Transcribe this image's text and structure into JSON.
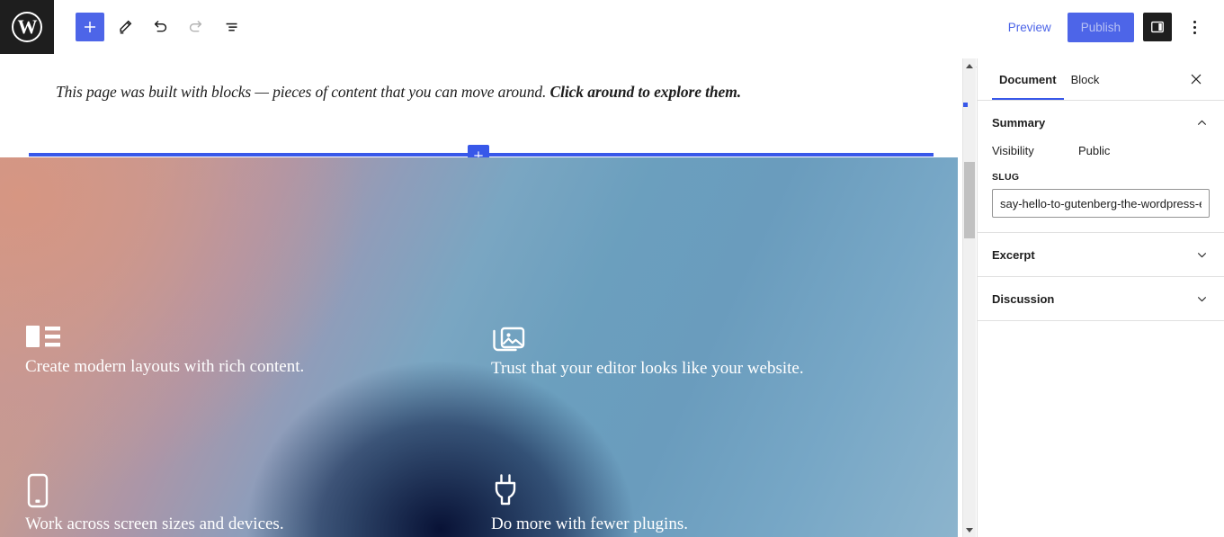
{
  "header": {
    "logo_title": "WordPress",
    "inserter_label": "Toggle block inserter",
    "tools": [
      {
        "name": "edit-pencil-icon",
        "label": "Tools",
        "disabled": false
      },
      {
        "name": "undo-icon",
        "label": "Undo",
        "disabled": false
      },
      {
        "name": "redo-icon",
        "label": "Redo",
        "disabled": true
      },
      {
        "name": "list-view-icon",
        "label": "Document Overview",
        "disabled": false
      }
    ],
    "preview_label": "Preview",
    "publish_label": "Publish",
    "sidebar_toggle_label": "Settings",
    "more_menu_label": "Options"
  },
  "editor": {
    "intro_text_plain": "This page was built with blocks — pieces of content that you can move around. ",
    "intro_text_bold": "Click around to explore them.",
    "inserter_between_label": "Add block",
    "cover": {
      "features": [
        {
          "icon": "columns-layout-icon",
          "text": "Create modern layouts with rich content."
        },
        {
          "icon": "image-gallery-icon",
          "text": "Trust that your editor looks like your website."
        },
        {
          "icon": "smartphone-icon",
          "text": "Work across screen sizes and devices."
        },
        {
          "icon": "plug-icon",
          "text": "Do more with fewer plugins."
        }
      ]
    },
    "scrollbar": {
      "up_label": "Scroll up",
      "down_label": "Scroll down",
      "thumb_label": "Vertical scrollbar thumb"
    }
  },
  "sidebar": {
    "tabs": [
      {
        "label": "Document",
        "active": true
      },
      {
        "label": "Block",
        "active": false
      }
    ],
    "close_label": "Close settings",
    "panels": [
      {
        "title": "Summary",
        "expanded": true
      },
      {
        "title": "Excerpt",
        "expanded": false
      },
      {
        "title": "Discussion",
        "expanded": false
      }
    ],
    "summary": {
      "visibility_label": "Visibility",
      "visibility_value": "Public",
      "slug_label": "SLUG",
      "slug_value": "say-hello-to-gutenberg-the-wordpress-editor"
    }
  },
  "colors": {
    "accent_blue": "#3858e9",
    "button_blue": "#4d65e8",
    "dark_chrome": "#1e1e1e",
    "border_grey": "#e0e0e0",
    "scrollbar_thumb": "#c1c1c1"
  }
}
